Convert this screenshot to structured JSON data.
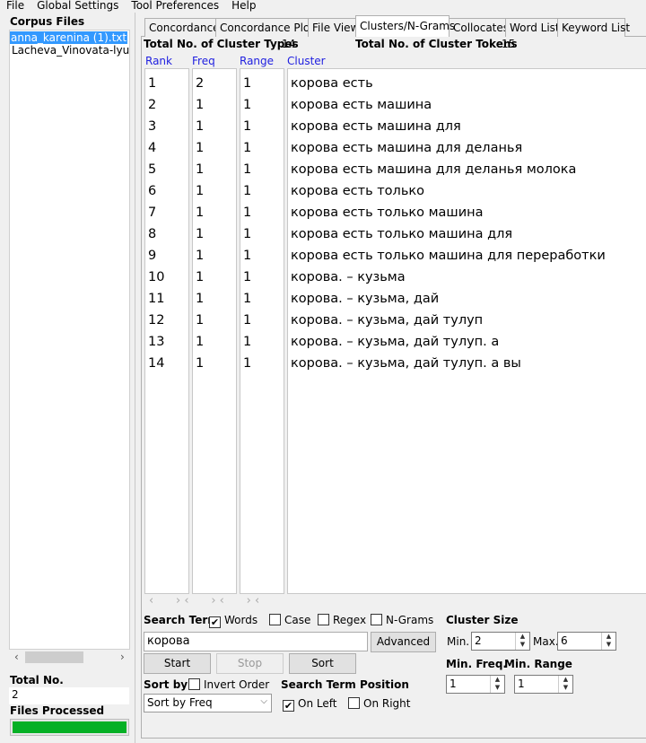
{
  "menu": [
    "File",
    "Global Settings",
    "Tool Preferences",
    "Help"
  ],
  "sidebar": {
    "title": "Corpus Files",
    "files": [
      "anna_karenina (1).txt",
      "Lacheva_Vinovata-lyub"
    ],
    "total_label": "Total No.",
    "total_value": "2",
    "processed_label": "Files Processed",
    "progress": 1.0
  },
  "tabs": [
    "Concordance",
    "Concordance Plot",
    "File View",
    "Clusters/N-Grams",
    "Collocates",
    "Word List",
    "Keyword List"
  ],
  "stats": {
    "types_label": "Total No. of Cluster Types",
    "types_value": "14",
    "tokens_label": "Total No. of Cluster Tokens",
    "tokens_value": "15"
  },
  "columns": [
    "Rank",
    "Freq",
    "Range",
    "Cluster"
  ],
  "rows": [
    [
      "1",
      "2",
      "1",
      "корова есть"
    ],
    [
      "2",
      "1",
      "1",
      "корова есть машина"
    ],
    [
      "3",
      "1",
      "1",
      "корова есть машина для"
    ],
    [
      "4",
      "1",
      "1",
      "корова есть машина для деланья"
    ],
    [
      "5",
      "1",
      "1",
      "корова есть машина для деланья молока"
    ],
    [
      "6",
      "1",
      "1",
      "корова есть только"
    ],
    [
      "7",
      "1",
      "1",
      "корова есть только машина"
    ],
    [
      "8",
      "1",
      "1",
      "корова есть только машина для"
    ],
    [
      "9",
      "1",
      "1",
      "корова есть только машина для переработки"
    ],
    [
      "10",
      "1",
      "1",
      "корова.  – кузьма"
    ],
    [
      "11",
      "1",
      "1",
      "корова.  – кузьма, дай"
    ],
    [
      "12",
      "1",
      "1",
      "корова.  – кузьма, дай тулуп"
    ],
    [
      "13",
      "1",
      "1",
      "корова.  – кузьма, дай тулуп. а"
    ],
    [
      "14",
      "1",
      "1",
      "корова.  – кузьма, дай тулуп. а вы"
    ]
  ],
  "controls": {
    "search_term_label": "Search Term",
    "words": "Words",
    "case": "Case",
    "regex": "Regex",
    "ngrams": "N-Grams",
    "search_value": "корова",
    "advanced": "Advanced",
    "start": "Start",
    "stop": "Stop",
    "sort": "Sort",
    "sort_by_label": "Sort by",
    "invert_order": "Invert Order",
    "sort_select": "Sort by Freq",
    "position_label": "Search Term Position",
    "on_left": "On Left",
    "on_right": "On Right",
    "cluster_size_label": "Cluster Size",
    "min_label": "Min.",
    "min_value": "2",
    "max_label": "Max.",
    "max_value": "6",
    "min_freq_label": "Min. Freq.",
    "min_freq_value": "1",
    "min_range_label": "Min. Range",
    "min_range_value": "1"
  },
  "colors": {
    "selection": "#3399ff",
    "progress": "#06b025",
    "header": "#2020e0"
  }
}
